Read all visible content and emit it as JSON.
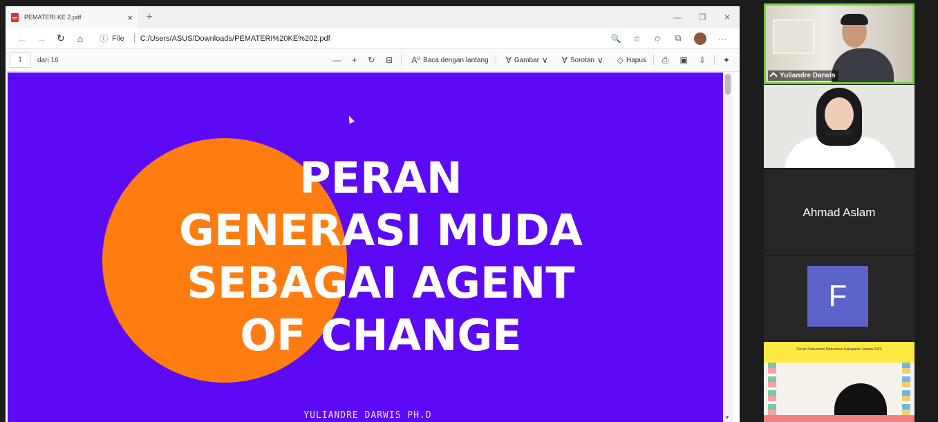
{
  "browser": {
    "tab_title": "PEMATERI KE 2.pdf",
    "tab_close": "×",
    "new_tab": "+",
    "address_info": "ⓘ",
    "address_scheme": "File",
    "url": "C:/Users/ASUS/Downloads/PEMATERI%20KE%202.pdf"
  },
  "pdf_toolbar": {
    "page_number": "1",
    "page_of": "dari 16",
    "read_aloud": "Baca dengan lantang",
    "draw": "Gambar",
    "highlight": "Sorotan",
    "erase": "Hapus"
  },
  "slide": {
    "title_line1": "PERAN",
    "title_line2": "GENERASI MUDA",
    "title_line3": "SEBAGAI AGENT",
    "title_line4": "OF CHANGE",
    "author": "YULIANDRE DARWIS PH.D",
    "background_color": "#5c0af5",
    "circle_color": "#ff7d10"
  },
  "participants": {
    "p1_name": "Yuliandre Darwis",
    "p3_name": "Ahmad Aslam",
    "p4_initial": "F",
    "p5_header": "Forum Silaturahmi Mahasiswa Kabupaten Jakarta 2020",
    "active_speaker_color": "#6fd13a"
  },
  "icons": {
    "pdf_file": "pdf-icon",
    "back": "←",
    "forward": "→",
    "refresh": "↻",
    "home": "⌂",
    "zoom": "🔍",
    "favorite": "☆",
    "favorites_list": "✩",
    "collections": "⧉",
    "more": "···",
    "zoom_out": "—",
    "zoom_in": "+",
    "rotate": "↻",
    "fit": "⊟",
    "read_aloud_icon": "A⁰",
    "draw_icon": "∀",
    "chevron": "∨",
    "erase_icon": "◇",
    "print": "⎙",
    "save": "▣",
    "save_as": "⇩",
    "pin": "📌"
  }
}
